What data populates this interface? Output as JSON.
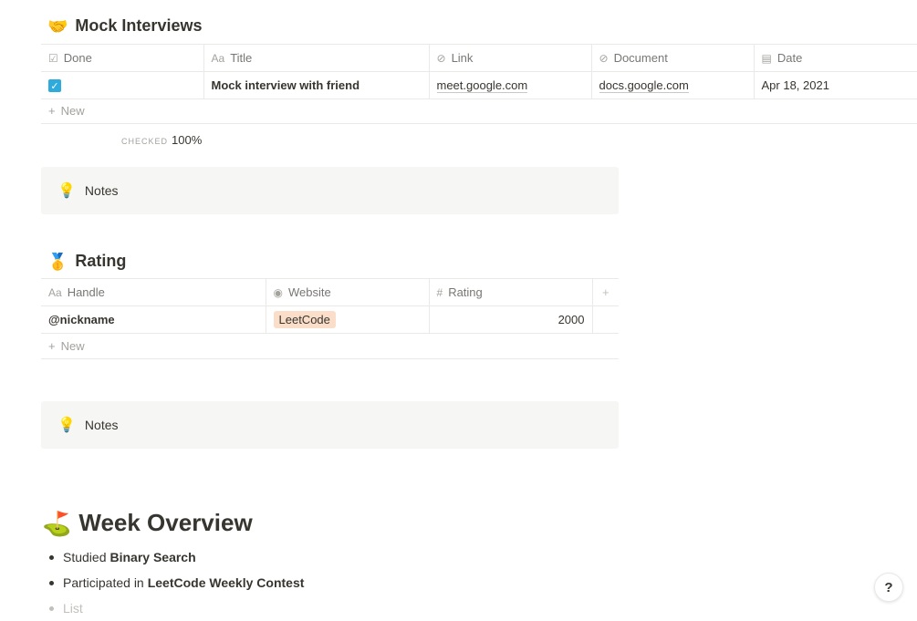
{
  "mock": {
    "emoji": "🤝",
    "title": "Mock Interviews",
    "columns": [
      {
        "icon": "☑",
        "label": "Done"
      },
      {
        "icon": "Aa",
        "label": "Title"
      },
      {
        "icon": "⊘",
        "label": "Link"
      },
      {
        "icon": "⊘",
        "label": "Document"
      },
      {
        "icon": "▤",
        "label": "Date"
      }
    ],
    "row": {
      "done": true,
      "title": "Mock interview with friend",
      "link": "meet.google.com",
      "document": "docs.google.com",
      "date": "Apr 18, 2021"
    },
    "new_label": "New",
    "calc_caption": "CHECKED",
    "calc_value": "100%"
  },
  "callout1": {
    "emoji": "💡",
    "text": "Notes"
  },
  "rating": {
    "emoji": "🥇",
    "title": "Rating",
    "columns": [
      {
        "icon": "Aa",
        "label": "Handle"
      },
      {
        "icon": "◉",
        "label": "Website"
      },
      {
        "icon": "#",
        "label": "Rating"
      }
    ],
    "add_col": "+",
    "row": {
      "handle": "@nickname",
      "website": "LeetCode",
      "rating": "2000"
    },
    "new_label": "New"
  },
  "callout2": {
    "emoji": "💡",
    "text": "Notes"
  },
  "week": {
    "emoji": "⛳",
    "title": "Week Overview",
    "bullets": [
      {
        "prefix": "Studied ",
        "bold": "Binary Search"
      },
      {
        "prefix": "Participated in ",
        "bold": "LeetCode Weekly Contest"
      }
    ],
    "placeholder": "List"
  },
  "help_label": "?"
}
